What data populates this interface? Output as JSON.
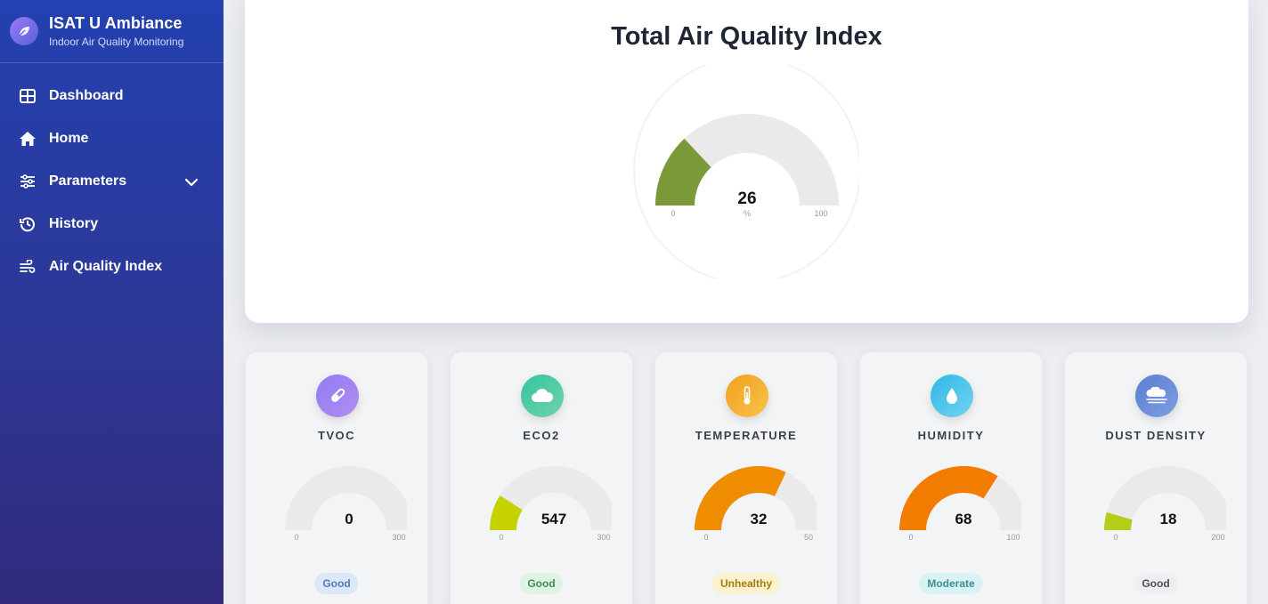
{
  "brand": {
    "title": "ISAT U Ambiance",
    "subtitle": "Indoor Air Quality Monitoring"
  },
  "nav": {
    "items": [
      {
        "label": "Dashboard"
      },
      {
        "label": "Home"
      },
      {
        "label": "Parameters"
      },
      {
        "label": "History"
      },
      {
        "label": "Air Quality Index"
      }
    ]
  },
  "main": {
    "title": "Total Air Quality Index",
    "gauge": {
      "value": 26,
      "min": 0,
      "max": 100,
      "unit": "%",
      "color": "#7a9a3a"
    }
  },
  "cards": [
    {
      "label": "TVOC",
      "icon": "test-tube-icon",
      "value": 0,
      "min": 0,
      "max": 300,
      "min_label": "0",
      "max_label": "300",
      "fill": "#cccccc",
      "status": "Good",
      "badge_bg": "#dce8f8",
      "badge_fg": "#4f78bf",
      "icon_bg": [
        "#8f7bf5",
        "#b38df0"
      ]
    },
    {
      "label": "ECO2",
      "icon": "cloud-icon",
      "value": 547,
      "min": 0,
      "max": 3000,
      "min_label": "0",
      "max_label": "300",
      "fill": "#c5d200",
      "status": "Good",
      "badge_bg": "#dff3e4",
      "badge_fg": "#3f8e57",
      "icon_bg": [
        "#34c3a2",
        "#6fd3a8"
      ]
    },
    {
      "label": "TEMPERATURE",
      "icon": "thermometer-icon",
      "value": 32,
      "min": 0,
      "max": 50,
      "min_label": "0",
      "max_label": "50",
      "fill": "#f08c00",
      "status": "Unhealthy",
      "badge_bg": "#fbf1cf",
      "badge_fg": "#a27b10",
      "icon_bg": [
        "#f2a11f",
        "#f7c24a"
      ]
    },
    {
      "label": "HUMIDITY",
      "icon": "water-drop-icon",
      "value": 68,
      "min": 0,
      "max": 100,
      "min_label": "0",
      "max_label": "100",
      "fill": "#f27c00",
      "status": "Moderate",
      "badge_bg": "#d9f3f5",
      "badge_fg": "#3c8e97",
      "icon_bg": [
        "#2fb8e6",
        "#74d2f2"
      ]
    },
    {
      "label": "DUST DENSITY",
      "icon": "smog-icon",
      "value": 18,
      "min": 0,
      "max": 200,
      "min_label": "0",
      "max_label": "200",
      "fill": "#b4cc1a",
      "status": "Good",
      "badge_bg": "#eeeff1",
      "badge_fg": "#4a4e58",
      "icon_bg": [
        "#5a7fd2",
        "#7f9ee0"
      ]
    }
  ]
}
